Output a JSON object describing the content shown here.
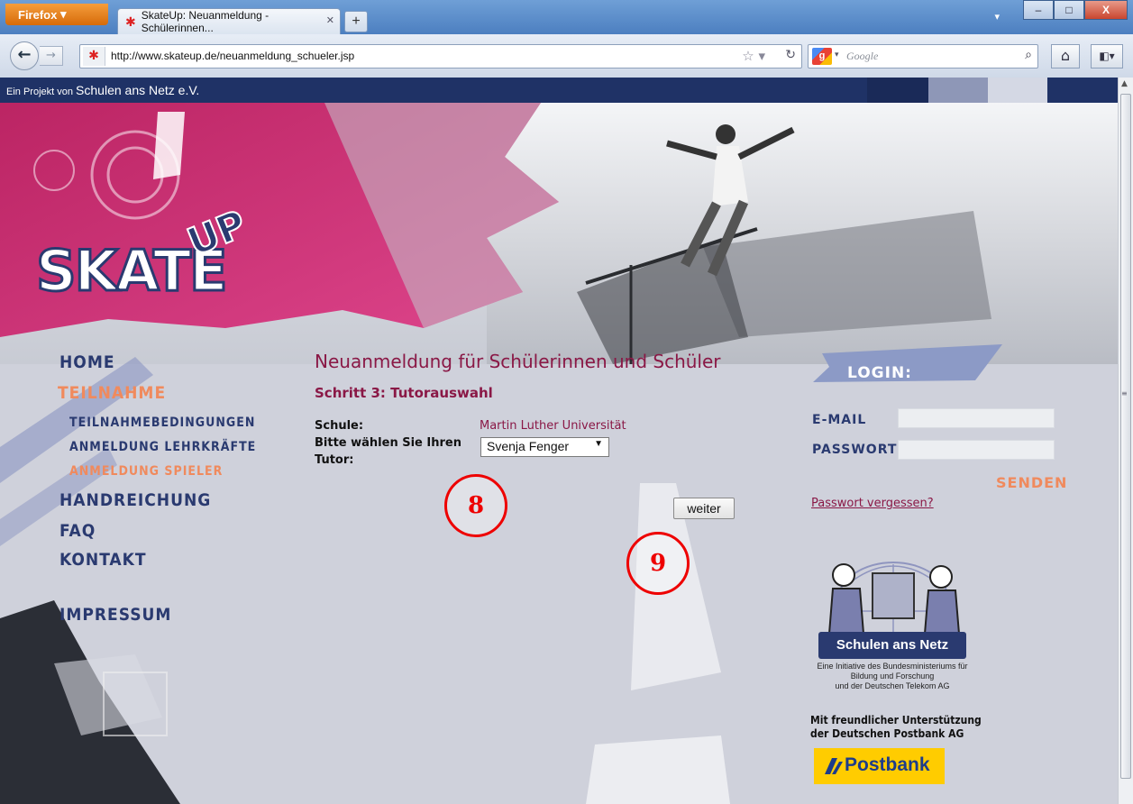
{
  "browser": {
    "menu_button": "Firefox",
    "tab_title": "SkateUp: Neuanmeldung - Schülerinnen...",
    "new_tab": "+",
    "url": "http://www.skateup.de/neuanmeldung_schueler.jsp",
    "search_placeholder": "Google",
    "window_controls": {
      "minimize": "–",
      "maximize": "□",
      "close": "X"
    }
  },
  "page": {
    "top_strip": {
      "prefix": "Ein Projekt von",
      "org": "Schulen ans Netz e.V."
    },
    "logo": {
      "main": "SKATE",
      "accent": "UP"
    },
    "nav": {
      "home": "HOME",
      "teilnahme": "TEILNAHME",
      "teilnahmebedingungen": "TEILNAHMEBEDINGUNGEN",
      "anmeldung_lehrkraefte": "ANMELDUNG LEHRKRÄFTE",
      "anmeldung_spieler": "ANMELDUNG SPIELER",
      "handreichung": "HANDREICHUNG",
      "faq": "FAQ",
      "kontakt": "KONTAKT",
      "impressum": "IMPRESSUM"
    },
    "form": {
      "heading": "Neuanmeldung für Schülerinnen und Schüler",
      "step": "Schritt 3: Tutorauswahl",
      "school_label": "Schule:",
      "school_value": "Martin Luther Universität",
      "tutor_label_line1": "Bitte wählen Sie Ihren",
      "tutor_label_line2": "Tutor:",
      "tutor_selected": "Svenja Fenger",
      "next_button": "weiter"
    },
    "callouts": {
      "a": "8",
      "b": "9"
    },
    "login": {
      "title": "LOGIN:",
      "email_label": "E-MAIL",
      "password_label": "PASSWORT",
      "submit": "SENDEN",
      "forgot": "Passwort vergessen?"
    },
    "sponsor": {
      "san_label": "Schulen ans Netz",
      "san_caption_1": "Eine Initiative des Bundesministeriums für",
      "san_caption_2": "Bildung und Forschung",
      "san_caption_3": "und der Deutschen Telekom AG",
      "thanks_1": "Mit freundlicher Unterstützung",
      "thanks_2": "der Deutschen Postbank AG",
      "postbank": "Postbank"
    }
  },
  "colors": {
    "navy": "#2a3a70",
    "magenta": "#8a1846",
    "orange": "#f08a5d",
    "pink": "#d6206e"
  }
}
